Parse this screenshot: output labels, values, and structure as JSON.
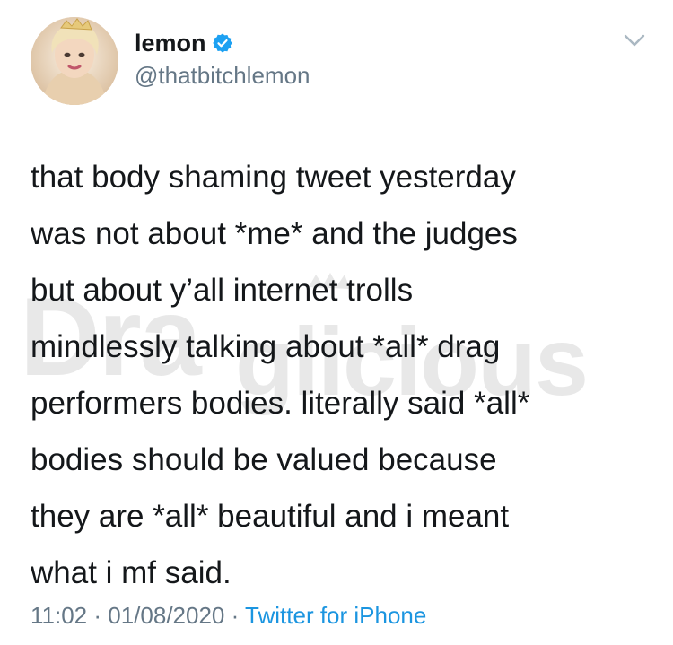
{
  "author": {
    "display_name": "lemon",
    "handle": "@thatbitchlemon",
    "verified": true,
    "avatar": "profile-photo"
  },
  "tweet": {
    "lines": [
      "that body shaming tweet yesterday",
      "was not about *me* and the judges",
      "but about y’all internet trolls",
      "mindlessly talking about *all* drag",
      "performers bodies. literally said *all*",
      "bodies should be valued because",
      "they are *all* beautiful and i meant",
      "what i mf said."
    ]
  },
  "meta": {
    "time": "11:02",
    "separator_1": " · ",
    "date": "01/08/2020",
    "separator_2": " · ",
    "source": "Twitter for iPhone"
  },
  "watermark": {
    "text": "Draglicious"
  },
  "colors": {
    "text": "#14171a",
    "secondary": "#657786",
    "link": "#1b95e0",
    "verified": "#1da1f2"
  },
  "icons": {
    "verified": "verified-badge-icon",
    "more": "chevron-down-icon"
  }
}
